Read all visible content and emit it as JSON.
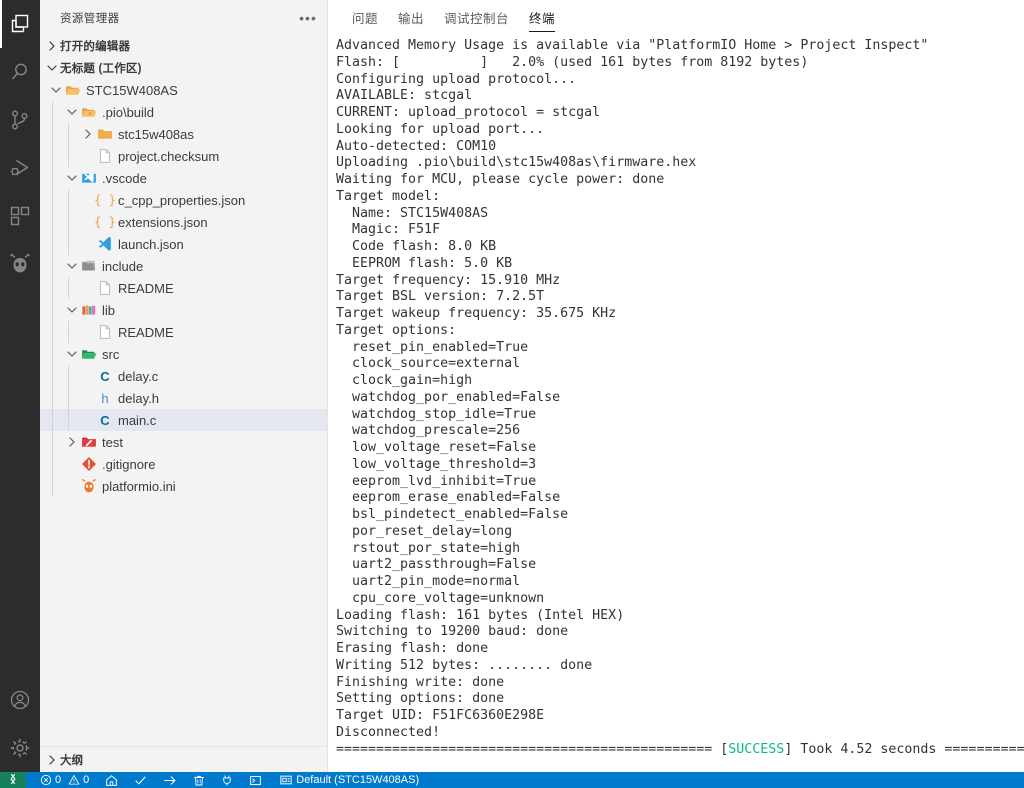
{
  "activity_bar": {
    "items": [
      {
        "name": "explorer",
        "icon": "files-icon",
        "active": true
      },
      {
        "name": "search",
        "icon": "search-icon",
        "active": false
      },
      {
        "name": "source-control",
        "icon": "source-control-icon",
        "active": false
      },
      {
        "name": "run-and-debug",
        "icon": "run-debug-icon",
        "active": false
      },
      {
        "name": "extensions",
        "icon": "extensions-icon",
        "active": false
      },
      {
        "name": "platformio",
        "icon": "platformio-alien-icon",
        "active": false
      }
    ],
    "bottom_items": [
      {
        "name": "accounts",
        "icon": "account-icon"
      },
      {
        "name": "manage",
        "icon": "gear-icon"
      }
    ]
  },
  "sidebar": {
    "title": "资源管理器",
    "more_label": "•••",
    "sections": [
      {
        "label": "打开的编辑器",
        "expanded": false
      },
      {
        "label": "无标题 (工作区)",
        "expanded": true
      }
    ],
    "outline_label": "大纲",
    "tree": [
      {
        "label": "STC15W408AS",
        "depth": 1,
        "twisty": "down",
        "icon": "folder-open-root-icon",
        "selected": false
      },
      {
        "label": ".pio\\build",
        "depth": 2,
        "twisty": "down",
        "icon": "folder-open-icon",
        "selected": false
      },
      {
        "label": "stc15w408as",
        "depth": 3,
        "twisty": "right",
        "icon": "folder-icon",
        "selected": false
      },
      {
        "label": "project.checksum",
        "depth": 3,
        "twisty": "none",
        "icon": "file-icon",
        "selected": false
      },
      {
        "label": ".vscode",
        "depth": 2,
        "twisty": "down",
        "icon": "vscode-folder-icon",
        "selected": false
      },
      {
        "label": "c_cpp_properties.json",
        "depth": 3,
        "twisty": "none",
        "icon": "json-icon",
        "selected": false
      },
      {
        "label": "extensions.json",
        "depth": 3,
        "twisty": "none",
        "icon": "json-icon",
        "selected": false
      },
      {
        "label": "launch.json",
        "depth": 3,
        "twisty": "none",
        "icon": "vscode-file-icon",
        "selected": false
      },
      {
        "label": "include",
        "depth": 2,
        "twisty": "down",
        "icon": "folder-include-icon",
        "selected": false
      },
      {
        "label": "README",
        "depth": 3,
        "twisty": "none",
        "icon": "file-icon",
        "selected": false
      },
      {
        "label": "lib",
        "depth": 2,
        "twisty": "down",
        "icon": "folder-lib-icon",
        "selected": false
      },
      {
        "label": "README",
        "depth": 3,
        "twisty": "none",
        "icon": "file-icon",
        "selected": false
      },
      {
        "label": "src",
        "depth": 2,
        "twisty": "down",
        "icon": "folder-src-icon",
        "selected": false
      },
      {
        "label": "delay.c",
        "depth": 3,
        "twisty": "none",
        "icon": "c-file-icon",
        "selected": false
      },
      {
        "label": "delay.h",
        "depth": 3,
        "twisty": "none",
        "icon": "h-file-icon",
        "selected": false
      },
      {
        "label": "main.c",
        "depth": 3,
        "twisty": "none",
        "icon": "c-file-icon",
        "selected": true
      },
      {
        "label": "test",
        "depth": 2,
        "twisty": "right",
        "icon": "folder-test-icon",
        "selected": false
      },
      {
        "label": ".gitignore",
        "depth": 2,
        "twisty": "none",
        "icon": "git-icon",
        "selected": false
      },
      {
        "label": "platformio.ini",
        "depth": 2,
        "twisty": "none",
        "icon": "platformio-file-icon",
        "selected": false
      }
    ]
  },
  "panel": {
    "tabs": [
      {
        "label": "问题",
        "active": false
      },
      {
        "label": "输出",
        "active": false
      },
      {
        "label": "调试控制台",
        "active": false
      },
      {
        "label": "终端",
        "active": true
      }
    ],
    "terminal_lines": [
      "Advanced Memory Usage is available via \"PlatformIO Home > Project Inspect\"",
      "Flash: [          ]   2.0% (used 161 bytes from 8192 bytes)",
      "Configuring upload protocol...",
      "AVAILABLE: stcgal",
      "CURRENT: upload_protocol = stcgal",
      "Looking for upload port...",
      "Auto-detected: COM10",
      "Uploading .pio\\build\\stc15w408as\\firmware.hex",
      "Waiting for MCU, please cycle power: done",
      "Target model:",
      "  Name: STC15W408AS",
      "  Magic: F51F",
      "  Code flash: 8.0 KB",
      "  EEPROM flash: 5.0 KB",
      "Target frequency: 15.910 MHz",
      "Target BSL version: 7.2.5T",
      "Target wakeup frequency: 35.675 KHz",
      "Target options:",
      "  reset_pin_enabled=True",
      "  clock_source=external",
      "  clock_gain=high",
      "  watchdog_por_enabled=False",
      "  watchdog_stop_idle=True",
      "  watchdog_prescale=256",
      "  low_voltage_reset=False",
      "  low_voltage_threshold=3",
      "  eeprom_lvd_inhibit=True",
      "  eeprom_erase_enabled=False",
      "  bsl_pindetect_enabled=False",
      "  por_reset_delay=long",
      "  rstout_por_state=high",
      "  uart2_passthrough=False",
      "  uart2_pin_mode=normal",
      "  cpu_core_voltage=unknown",
      "Loading flash: 161 bytes (Intel HEX)",
      "Switching to 19200 baud: done",
      "Erasing flash: done",
      "Writing 512 bytes: ........ done",
      "Finishing write: done",
      "Setting options: done",
      "Target UID: F51FC6360E298E",
      "Disconnected!"
    ],
    "final_line": {
      "prefix": "=============================================== [",
      "status": "SUCCESS",
      "suffix": "] Took 4.52 seconds ==============================="
    }
  },
  "status_bar": {
    "remote_icon": "remote-window-icon",
    "errors_count": "0",
    "warnings_count": "0",
    "items": [
      {
        "name": "pio-home",
        "icon": "home-icon"
      },
      {
        "name": "pio-build",
        "icon": "check-icon"
      },
      {
        "name": "pio-upload",
        "icon": "arrow-right-icon"
      },
      {
        "name": "pio-clean",
        "icon": "trash-icon"
      },
      {
        "name": "pio-monitor",
        "icon": "plug-icon"
      },
      {
        "name": "pio-terminal",
        "icon": "terminal-icon"
      }
    ],
    "env_icon": "board-icon",
    "env_label": "Default (STC15W408AS)"
  },
  "colors": {
    "accent": "#007acc",
    "remote_green": "#16825d",
    "success_green": "#0dbc79",
    "selection": "#e4e6f1",
    "sidebar_bg": "#f3f3f3",
    "activity_bg": "#2c2c2c"
  }
}
